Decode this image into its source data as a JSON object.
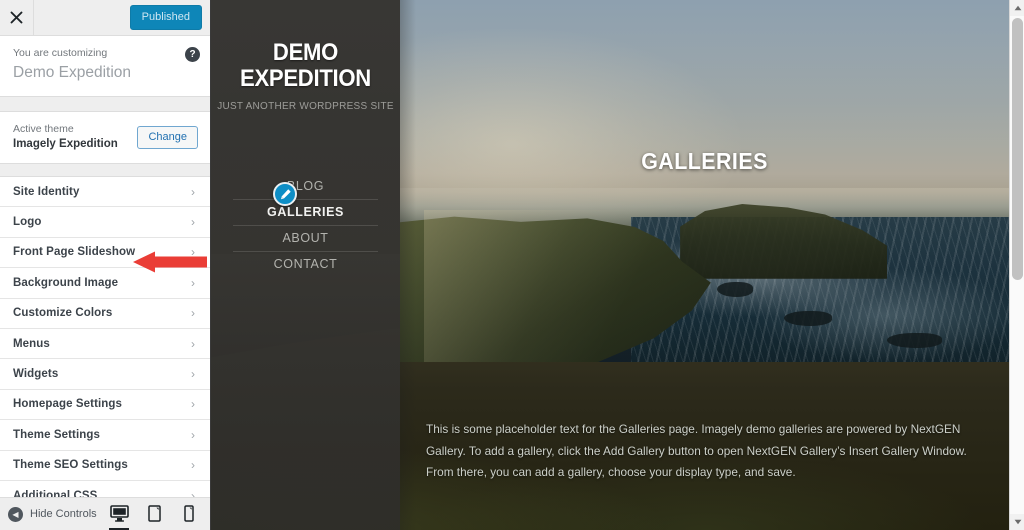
{
  "customizer": {
    "close_label": "Close",
    "publish_label": "Published",
    "customizing_label": "You are customizing",
    "site_name": "Demo Expedition",
    "help_label": "?",
    "active_theme_label": "Active theme",
    "active_theme_name": "Imagely Expedition",
    "change_button_label": "Change",
    "panels": [
      {
        "label": "Site Identity"
      },
      {
        "label": "Logo"
      },
      {
        "label": "Front Page Slideshow"
      },
      {
        "label": "Background Image"
      },
      {
        "label": "Customize Colors"
      },
      {
        "label": "Menus"
      },
      {
        "label": "Widgets"
      },
      {
        "label": "Homepage Settings"
      },
      {
        "label": "Theme Settings"
      },
      {
        "label": "Theme SEO Settings"
      },
      {
        "label": "Additional CSS"
      }
    ],
    "hide_controls_label": "Hide Controls",
    "devices": [
      {
        "name": "desktop",
        "active": true
      },
      {
        "name": "tablet",
        "active": false
      },
      {
        "name": "mobile",
        "active": false
      }
    ],
    "accent_blue": "#0e86b8",
    "annotation_arrow_color": "#ea3d36"
  },
  "preview": {
    "site_title": "DEMO EXPEDITION",
    "tagline": "JUST ANOTHER WORDPRESS SITE",
    "nav": [
      {
        "label": "BLOG",
        "current": false
      },
      {
        "label": "GALLERIES",
        "current": true
      },
      {
        "label": "ABOUT",
        "current": false
      },
      {
        "label": "CONTACT",
        "current": false
      }
    ],
    "edit_shortcut_name": "pencil-icon",
    "hero_title": "GALLERIES",
    "body_text": "This is some placeholder text for the Galleries page. Imagely demo galleries are powered by NextGEN Gallery. To add a gallery, click the Add Gallery button to open NextGEN Gallery’s Insert Gallery Window. From there, you can add a gallery, choose your display type, and save."
  }
}
